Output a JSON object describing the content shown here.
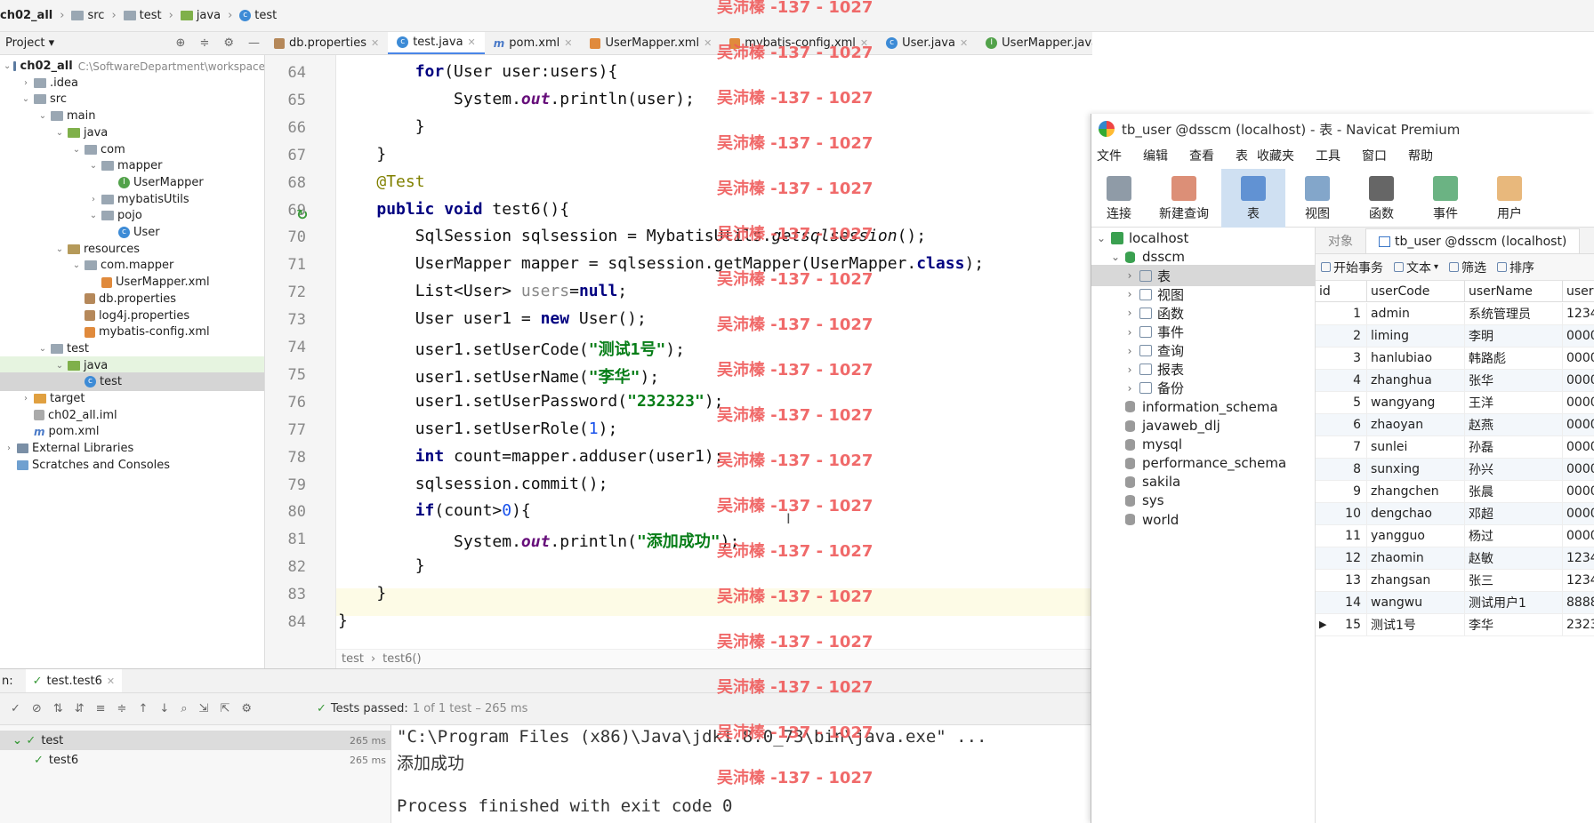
{
  "breadcrumb": [
    {
      "label": "ch02_all",
      "icon": "none"
    },
    {
      "label": "src",
      "icon": "folder-icon"
    },
    {
      "label": "test",
      "icon": "folder-icon"
    },
    {
      "label": "java",
      "icon": "java-folder-icon"
    },
    {
      "label": "test",
      "icon": "class-icon"
    }
  ],
  "project_panel": {
    "title": "Project"
  },
  "editor_tabs": [
    {
      "label": "db.properties",
      "icon": "properties-icon",
      "active": false
    },
    {
      "label": "test.java",
      "icon": "class-icon",
      "active": true
    },
    {
      "label": "pom.xml",
      "icon": "maven-icon",
      "active": false
    },
    {
      "label": "UserMapper.xml",
      "icon": "xml-icon",
      "active": false
    },
    {
      "label": "mybatis-config.xml",
      "icon": "xml-icon",
      "active": false
    },
    {
      "label": "User.java",
      "icon": "class-icon",
      "active": false
    },
    {
      "label": "UserMapper.java",
      "icon": "interface-icon",
      "active": false
    }
  ],
  "tree": [
    {
      "label": "ch02_all",
      "extra": "C:\\SoftwareDepartment\\workspace",
      "depth": 0,
      "arrow": "down",
      "icon": "module-icon",
      "bold": true
    },
    {
      "label": ".idea",
      "depth": 1,
      "arrow": "right",
      "icon": "folder-icon"
    },
    {
      "label": "src",
      "depth": 1,
      "arrow": "down",
      "icon": "folder-icon"
    },
    {
      "label": "main",
      "depth": 2,
      "arrow": "down",
      "icon": "folder-icon"
    },
    {
      "label": "java",
      "depth": 3,
      "arrow": "down",
      "icon": "java-folder-icon"
    },
    {
      "label": "com",
      "depth": 4,
      "arrow": "down",
      "icon": "package-icon"
    },
    {
      "label": "mapper",
      "depth": 5,
      "arrow": "down",
      "icon": "package-icon"
    },
    {
      "label": "UserMapper",
      "depth": 6,
      "arrow": "",
      "icon": "interface-icon"
    },
    {
      "label": "mybatisUtils",
      "depth": 5,
      "arrow": "right",
      "icon": "package-icon"
    },
    {
      "label": "pojo",
      "depth": 5,
      "arrow": "down",
      "icon": "package-icon"
    },
    {
      "label": "User",
      "depth": 6,
      "arrow": "",
      "icon": "class-icon"
    },
    {
      "label": "resources",
      "depth": 3,
      "arrow": "down",
      "icon": "resources-folder-icon"
    },
    {
      "label": "com.mapper",
      "depth": 4,
      "arrow": "down",
      "icon": "package-icon"
    },
    {
      "label": "UserMapper.xml",
      "depth": 5,
      "arrow": "",
      "icon": "xml-icon"
    },
    {
      "label": "db.properties",
      "depth": 4,
      "arrow": "",
      "icon": "properties-icon"
    },
    {
      "label": "log4j.properties",
      "depth": 4,
      "arrow": "",
      "icon": "properties-icon"
    },
    {
      "label": "mybatis-config.xml",
      "depth": 4,
      "arrow": "",
      "icon": "xml-icon"
    },
    {
      "label": "test",
      "depth": 2,
      "arrow": "down",
      "icon": "folder-icon"
    },
    {
      "label": "java",
      "depth": 3,
      "arrow": "down",
      "icon": "java-folder-icon",
      "highlight": true
    },
    {
      "label": "test",
      "depth": 4,
      "arrow": "",
      "icon": "class-icon",
      "selected": true
    },
    {
      "label": "target",
      "depth": 1,
      "arrow": "right",
      "icon": "target-folder-icon"
    },
    {
      "label": "ch02_all.iml",
      "depth": 1,
      "arrow": "",
      "icon": "iml-icon"
    },
    {
      "label": "pom.xml",
      "depth": 1,
      "arrow": "",
      "icon": "maven-icon"
    },
    {
      "label": "External Libraries",
      "depth": 0,
      "arrow": "right",
      "icon": "library-icon"
    },
    {
      "label": "Scratches and Consoles",
      "depth": 0,
      "arrow": "",
      "icon": "scratches-icon"
    }
  ],
  "editor": {
    "lines": [
      {
        "n": "64",
        "html": "        <span class=\"kw\">for</span>(User user:users){"
      },
      {
        "n": "65",
        "html": "            System.<span class=\"it\">out</span>.println(user);"
      },
      {
        "n": "66",
        "html": "        }"
      },
      {
        "n": "67",
        "html": "    }"
      },
      {
        "n": "68",
        "html": "    <span class=\"ann\">@Test</span>"
      },
      {
        "n": "69",
        "html": "    <span class=\"kw\">public void</span> test6(){"
      },
      {
        "n": "70",
        "html": "        SqlSession sqlsession = MybatisUtils.<span class=\"mit\">getsqlsession</span>();"
      },
      {
        "n": "71",
        "html": "        UserMapper mapper = sqlsession.getMapper(UserMapper.<span class=\"kw\">class</span>);"
      },
      {
        "n": "72",
        "html": "        List&lt;User&gt; <span style=\"color:#888\">users</span>=<span class=\"kw\">null</span>;"
      },
      {
        "n": "73",
        "html": "        User user1 = <span class=\"kw\">new</span> User();"
      },
      {
        "n": "74",
        "html": "        user1.setUserCode(<span class=\"str\">\"测试1号\"</span>);"
      },
      {
        "n": "75",
        "html": "        user1.setUserName(<span class=\"str\">\"李华\"</span>);"
      },
      {
        "n": "76",
        "html": "        user1.setUserPassword(<span class=\"str\">\"232323\"</span>);"
      },
      {
        "n": "77",
        "html": "        user1.setUserRole(<span class=\"num\">1</span>);"
      },
      {
        "n": "78",
        "html": "        <span class=\"kw\">int</span> count=mapper.adduser(user1);"
      },
      {
        "n": "79",
        "html": "        sqlsession.commit();"
      },
      {
        "n": "80",
        "html": "        <span class=\"kw\">if</span>(count&gt;<span class=\"num\">0</span>){"
      },
      {
        "n": "81",
        "html": "            System.<span class=\"it\">out</span>.println(<span class=\"str\">\"添加成功\"</span>);"
      },
      {
        "n": "82",
        "html": "        }"
      },
      {
        "n": "83",
        "html": "    }"
      },
      {
        "n": "84",
        "html": "}"
      }
    ],
    "bottom_breadcrumb": [
      "test",
      "test6()"
    ]
  },
  "run": {
    "label": "n:",
    "tab": "test.test6",
    "status": "Tests passed:",
    "status_detail": "1 of 1 test – 265 ms",
    "tree": [
      {
        "label": "test",
        "time": "265 ms"
      },
      {
        "label": "test6",
        "time": "265 ms"
      }
    ],
    "console": [
      "\"C:\\Program Files (x86)\\Java\\jdk1.8.0_73\\bin\\java.exe\" ...",
      "添加成功",
      "",
      "Process finished with exit code 0"
    ]
  },
  "navicat": {
    "title": "tb_user @dsscm (localhost) - 表 - Navicat Premium",
    "menu": [
      "文件",
      "编辑",
      "查看",
      "表",
      "收藏夹",
      "工具",
      "窗口",
      "帮助"
    ],
    "toolbar": [
      {
        "label": "连接",
        "icon": "connect-icon"
      },
      {
        "label": "新建查询",
        "icon": "new-query-icon"
      },
      {
        "label": "表",
        "icon": "table-icon",
        "active": true
      },
      {
        "label": "视图",
        "icon": "view-icon"
      },
      {
        "label": "函数",
        "icon": "function-icon"
      },
      {
        "label": "事件",
        "icon": "event-icon"
      },
      {
        "label": "用户",
        "icon": "user-icon"
      }
    ],
    "tree": [
      {
        "label": "localhost",
        "depth": 0,
        "arrow": "down",
        "icon": "server-icon"
      },
      {
        "label": "dsscm",
        "depth": 1,
        "arrow": "down",
        "icon": "database-icon"
      },
      {
        "label": "表",
        "depth": 2,
        "arrow": "right",
        "icon": "table-icon",
        "selected": true
      },
      {
        "label": "视图",
        "depth": 2,
        "arrow": "right",
        "icon": "view-icon"
      },
      {
        "label": "函数",
        "depth": 2,
        "arrow": "right",
        "icon": "function-icon"
      },
      {
        "label": "事件",
        "depth": 2,
        "arrow": "right",
        "icon": "event-icon"
      },
      {
        "label": "查询",
        "depth": 2,
        "arrow": "right",
        "icon": "query-icon"
      },
      {
        "label": "报表",
        "depth": 2,
        "arrow": "right",
        "icon": "report-icon"
      },
      {
        "label": "备份",
        "depth": 2,
        "arrow": "right",
        "icon": "backup-icon"
      },
      {
        "label": "information_schema",
        "depth": 1,
        "arrow": "",
        "icon": "database-icon"
      },
      {
        "label": "javaweb_dlj",
        "depth": 1,
        "arrow": "",
        "icon": "database-icon"
      },
      {
        "label": "mysql",
        "depth": 1,
        "arrow": "",
        "icon": "database-icon"
      },
      {
        "label": "performance_schema",
        "depth": 1,
        "arrow": "",
        "icon": "database-icon"
      },
      {
        "label": "sakila",
        "depth": 1,
        "arrow": "",
        "icon": "database-icon"
      },
      {
        "label": "sys",
        "depth": 1,
        "arrow": "",
        "icon": "database-icon"
      },
      {
        "label": "world",
        "depth": 1,
        "arrow": "",
        "icon": "database-icon"
      }
    ],
    "tabs": [
      {
        "label": "对象"
      },
      {
        "label": "tb_user @dsscm (localhost)"
      }
    ],
    "grid_toolbar": [
      "开始事务",
      "文本",
      "筛选",
      "排序"
    ],
    "columns": [
      "id",
      "userCode",
      "userName",
      "user"
    ],
    "rows": [
      [
        "1",
        "admin",
        "系统管理员",
        "1234"
      ],
      [
        "2",
        "liming",
        "李明",
        "0000"
      ],
      [
        "3",
        "hanlubiao",
        "韩路彪",
        "0000"
      ],
      [
        "4",
        "zhanghua",
        "张华",
        "0000"
      ],
      [
        "5",
        "wangyang",
        "王洋",
        "0000"
      ],
      [
        "6",
        "zhaoyan",
        "赵燕",
        "0000"
      ],
      [
        "7",
        "sunlei",
        "孙磊",
        "0000"
      ],
      [
        "8",
        "sunxing",
        "孙兴",
        "0000"
      ],
      [
        "9",
        "zhangchen",
        "张晨",
        "0000"
      ],
      [
        "10",
        "dengchao",
        "邓超",
        "0000"
      ],
      [
        "11",
        "yangguo",
        "杨过",
        "0000"
      ],
      [
        "12",
        "zhaomin",
        "赵敏",
        "1234"
      ],
      [
        "13",
        "zhangsan",
        "张三",
        "1234"
      ],
      [
        "14",
        "wangwu",
        "测试用户1",
        "8888"
      ],
      [
        "15",
        "测试1号",
        "李华",
        "2323"
      ]
    ]
  },
  "watermark": "吴沛榛 -137 - 1027",
  "colors": {
    "accent": "#4a86e8",
    "watermark": "#ef5a5a",
    "keyword": "#000080",
    "string": "#067d17"
  }
}
